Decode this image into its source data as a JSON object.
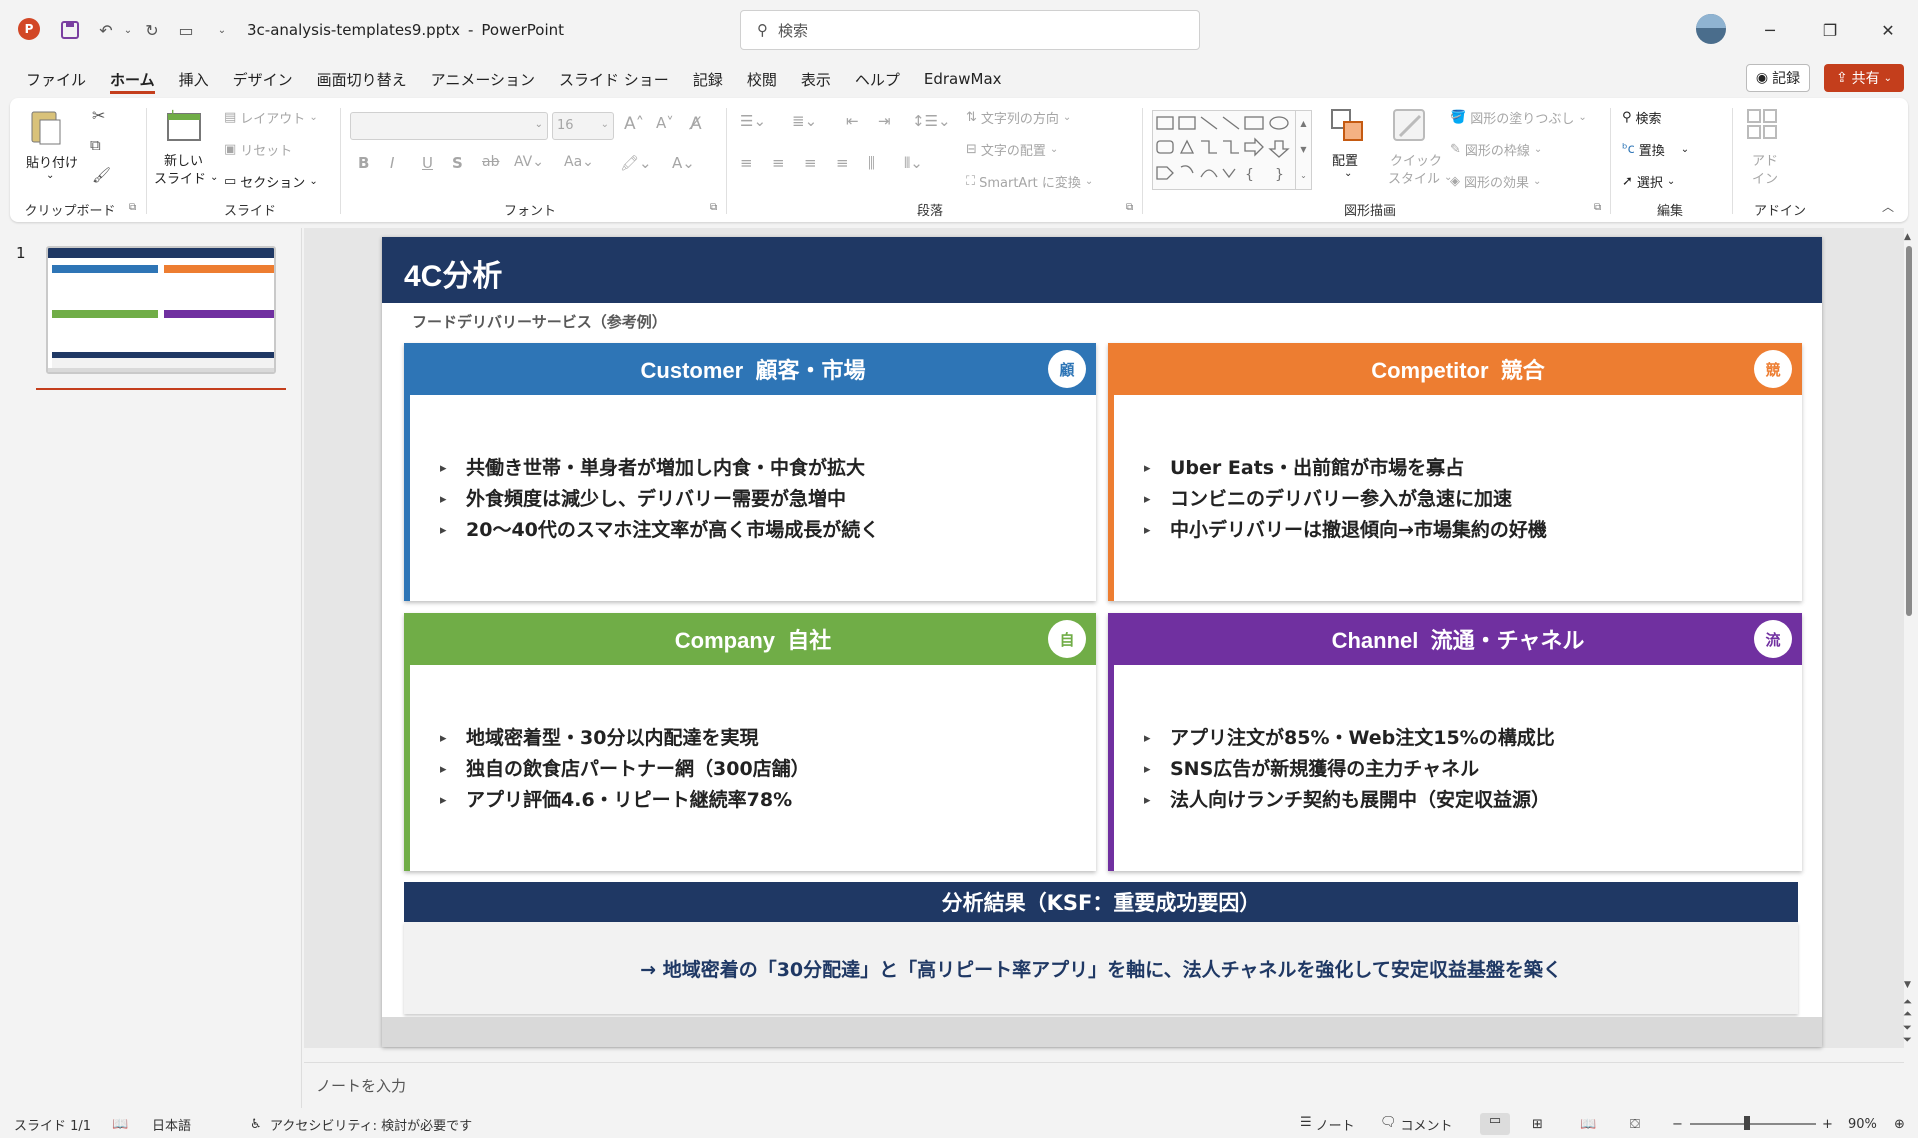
{
  "titlebar": {
    "filename": "3c-analysis-templates9.pptx",
    "separator": "-",
    "app": "PowerPoint",
    "search_placeholder": "検索"
  },
  "menu": [
    "ファイル",
    "ホーム",
    "挿入",
    "デザイン",
    "画面切り替え",
    "アニメーション",
    "スライド ショー",
    "記録",
    "校閲",
    "表示",
    "ヘルプ",
    "EdrawMax"
  ],
  "menu_right": {
    "record": "記録",
    "share": "共有"
  },
  "ribbon": {
    "clipboard": {
      "paste": "貼り付け",
      "label": "クリップボード"
    },
    "slides": {
      "new_slide_1": "新しい",
      "new_slide_2": "スライド",
      "layout": "レイアウト",
      "reset": "リセット",
      "section": "セクション",
      "label": "スライド"
    },
    "font": {
      "size": "16",
      "label": "フォント"
    },
    "paragraph": {
      "text_direction": "文字列の方向",
      "align_text": "文字の配置",
      "smartart": "SmartArt に変換",
      "label": "段落"
    },
    "drawing": {
      "arrange": "配置",
      "quick_style_1": "クイック",
      "quick_style_2": "スタイル",
      "fill": "図形の塗りつぶし",
      "outline": "図形の枠線",
      "effects": "図形の効果",
      "label": "図形描画"
    },
    "editing": {
      "find": "検索",
      "replace": "置換",
      "select": "選択",
      "label": "編集"
    },
    "addin": {
      "addin_1": "アド",
      "addin_2": "イン",
      "label": "アドイン"
    }
  },
  "thumbnail": {
    "number": "1"
  },
  "slide": {
    "title": "4C分析",
    "subtitle": "フードデリバリーサービス（参考例）",
    "cards": [
      {
        "title": "Customer  顧客・市場",
        "badge": "顧",
        "color": "#2e75b6",
        "bullets": [
          "共働き世帯・単身者が増加し内食・中食が拡大",
          "外食頻度は減少し、デリバリー需要が急増中",
          "20〜40代のスマホ注文率が高く市場成長が続く"
        ]
      },
      {
        "title": "Competitor  競合",
        "badge": "競",
        "color": "#ed7d31",
        "bullets": [
          "Uber Eats・出前館が市場を寡占",
          "コンビニのデリバリー参入が急速に加速",
          "中小デリバリーは撤退傾向→市場集約の好機"
        ]
      },
      {
        "title": "Company  自社",
        "badge": "自",
        "color": "#70ad47",
        "bullets": [
          "地域密着型・30分以内配達を実現",
          "独自の飲食店パートナー網（300店舗）",
          "アプリ評価4.6・リピート継続率78%"
        ]
      },
      {
        "title": "Channel  流通・チャネル",
        "badge": "流",
        "color": "#7030a0",
        "bullets": [
          "アプリ注文が85%・Web注文15%の構成比",
          "SNS広告が新規獲得の主力チャネル",
          "法人向けランチ契約も展開中（安定収益源）"
        ]
      }
    ],
    "ksf_title": "分析結果（KSF：重要成功要因）",
    "ksf_text": "→ 地域密着の「30分配達」と「高リピート率アプリ」を軸に、法人チャネルを強化して安定収益基盤を築く"
  },
  "notes_placeholder": "ノートを入力",
  "status": {
    "slide": "スライド 1/1",
    "language": "日本語",
    "accessibility": "アクセシビリティ: 検討が必要です",
    "notes": "ノート",
    "comments": "コメント",
    "zoom": "90%"
  }
}
